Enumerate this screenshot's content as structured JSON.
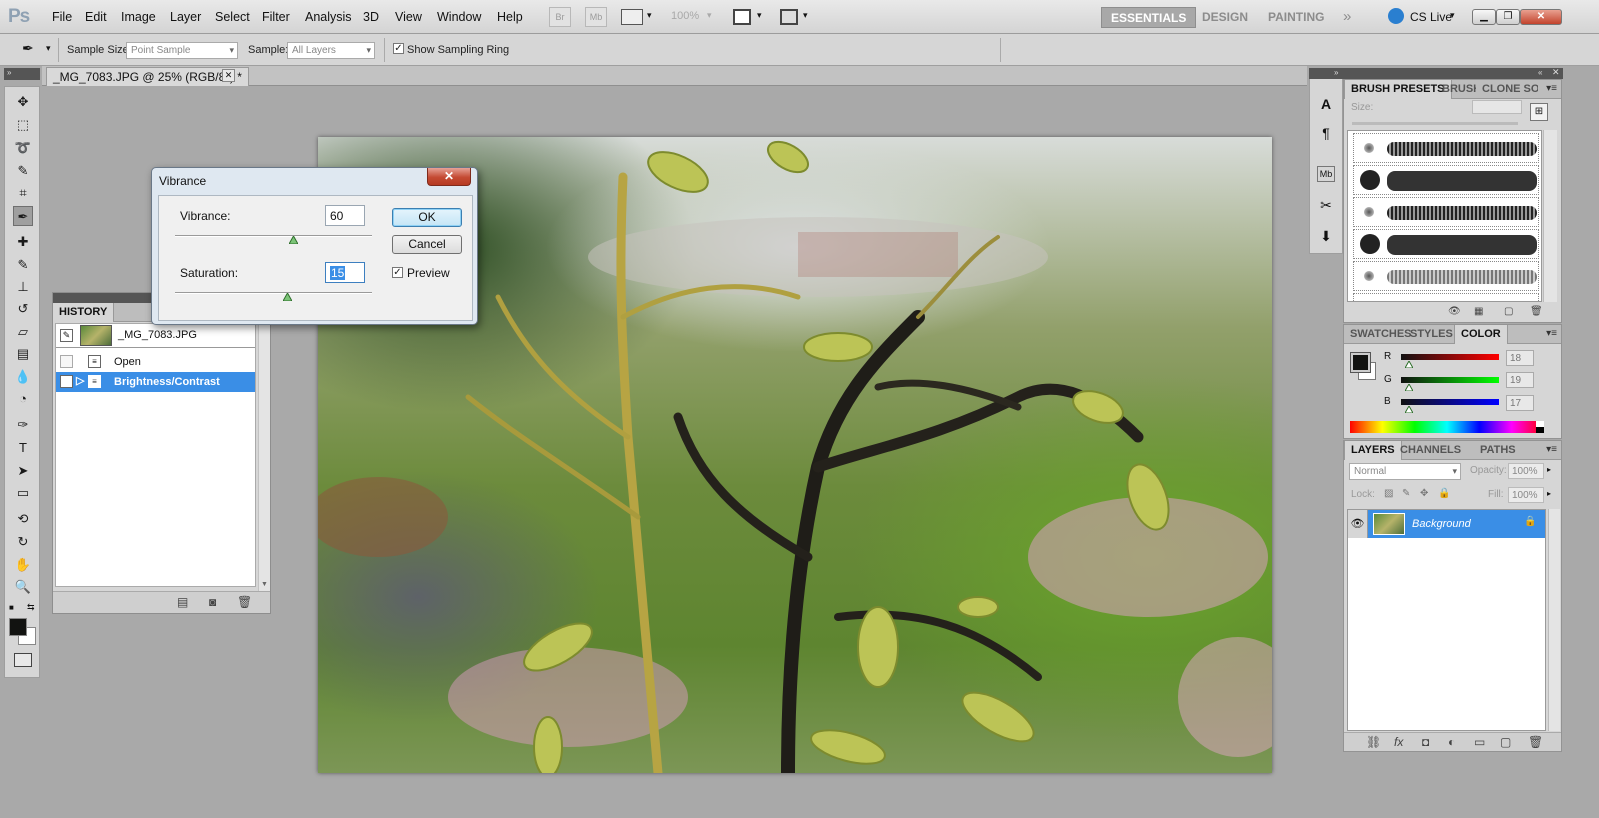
{
  "app": {
    "logo": "Ps"
  },
  "menu": [
    "File",
    "Edit",
    "Image",
    "Layer",
    "Select",
    "Filter",
    "Analysis",
    "3D",
    "View",
    "Window",
    "Help"
  ],
  "appbar": {
    "bridge": "Br",
    "mini_bridge": "Mb",
    "zoom": "100%"
  },
  "workspaces": [
    "ESSENTIALS",
    "DESIGN",
    "PAINTING"
  ],
  "cslive": "CS Live",
  "options": {
    "sample_size_label": "Sample Size:",
    "sample_size_value": "Point Sample",
    "sample_label": "Sample:",
    "sample_value": "All Layers",
    "show_ring_label": "Show Sampling Ring"
  },
  "document": {
    "tab_title": "_MG_7083.JPG @ 25% (RGB/8*) *"
  },
  "history": {
    "title": "HISTORY",
    "snapshot": "_MG_7083.JPG",
    "items": [
      "Open",
      "Brightness/Contrast"
    ]
  },
  "dialog": {
    "title": "Vibrance",
    "vibrance_label": "Vibrance:",
    "vibrance_value": "60",
    "saturation_label": "Saturation:",
    "saturation_value": "15",
    "ok": "OK",
    "cancel": "Cancel",
    "preview_label": "Preview",
    "vibrance_level_percent": 60,
    "saturation_level_percent": 57
  },
  "brush_panel": {
    "tabs": [
      "BRUSH PRESETS",
      "BRUSH",
      "CLONE SO"
    ],
    "size_label": "Size:"
  },
  "color_panel": {
    "tabs": [
      "SWATCHES",
      "STYLES",
      "COLOR"
    ],
    "channels": [
      {
        "label": "R",
        "value": "18"
      },
      {
        "label": "G",
        "value": "19"
      },
      {
        "label": "B",
        "value": "17"
      }
    ]
  },
  "layers_panel": {
    "tabs": [
      "LAYERS",
      "CHANNELS",
      "PATHS"
    ],
    "blend_mode": "Normal",
    "opacity_label": "Opacity:",
    "opacity_value": "100%",
    "lock_label": "Lock:",
    "fill_label": "Fill:",
    "fill_value": "100%",
    "layers": [
      "Background"
    ]
  },
  "colors": {
    "selection": "#3a8ee6",
    "foreground": "#121311",
    "background": "#ffffff"
  }
}
